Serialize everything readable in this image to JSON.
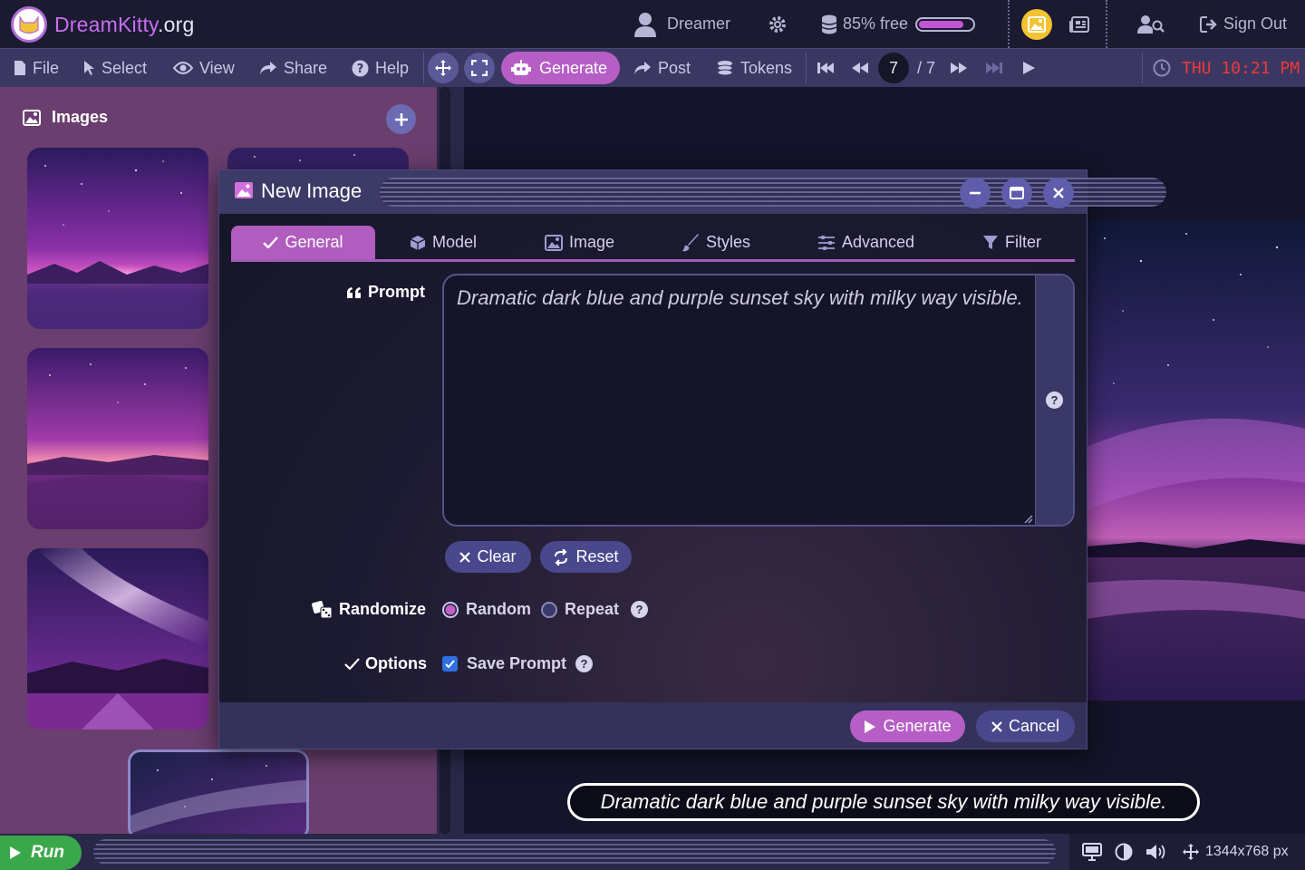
{
  "app": {
    "brand": "DreamKitty",
    "tld": ".org"
  },
  "topbar": {
    "user_name": "Dreamer",
    "storage_label": "85% free",
    "storage_fraction": 0.85,
    "sign_out": "Sign Out"
  },
  "menubar": {
    "items": [
      "File",
      "Select",
      "View",
      "Share",
      "Help"
    ],
    "generate": "Generate",
    "post": "Post",
    "tokens": "Tokens",
    "page_current": "7",
    "page_total": "/ 7",
    "clock": "THU 10:21 PM"
  },
  "sidebar": {
    "title": "Images"
  },
  "dialog": {
    "title": "New Image",
    "tabs": [
      "General",
      "Model",
      "Image",
      "Styles",
      "Advanced",
      "Filter"
    ],
    "active_tab": "General",
    "prompt_label": "Prompt",
    "prompt_value": "Dramatic dark blue and purple sunset sky with milky way visible.",
    "clear": "Clear",
    "reset": "Reset",
    "randomize_label": "Randomize",
    "random": "Random",
    "repeat": "Repeat",
    "options_label": "Options",
    "save_prompt": "Save Prompt",
    "generate": "Generate",
    "cancel": "Cancel"
  },
  "caption": "Dramatic dark blue and purple sunset sky with milky way visible.",
  "statusbar": {
    "run": "Run",
    "resolution": "1344x768 px"
  },
  "colors": {
    "accent": "#b65ec6",
    "brand": "#c86ef0",
    "clock": "#f03838",
    "run": "#3aa84a"
  }
}
